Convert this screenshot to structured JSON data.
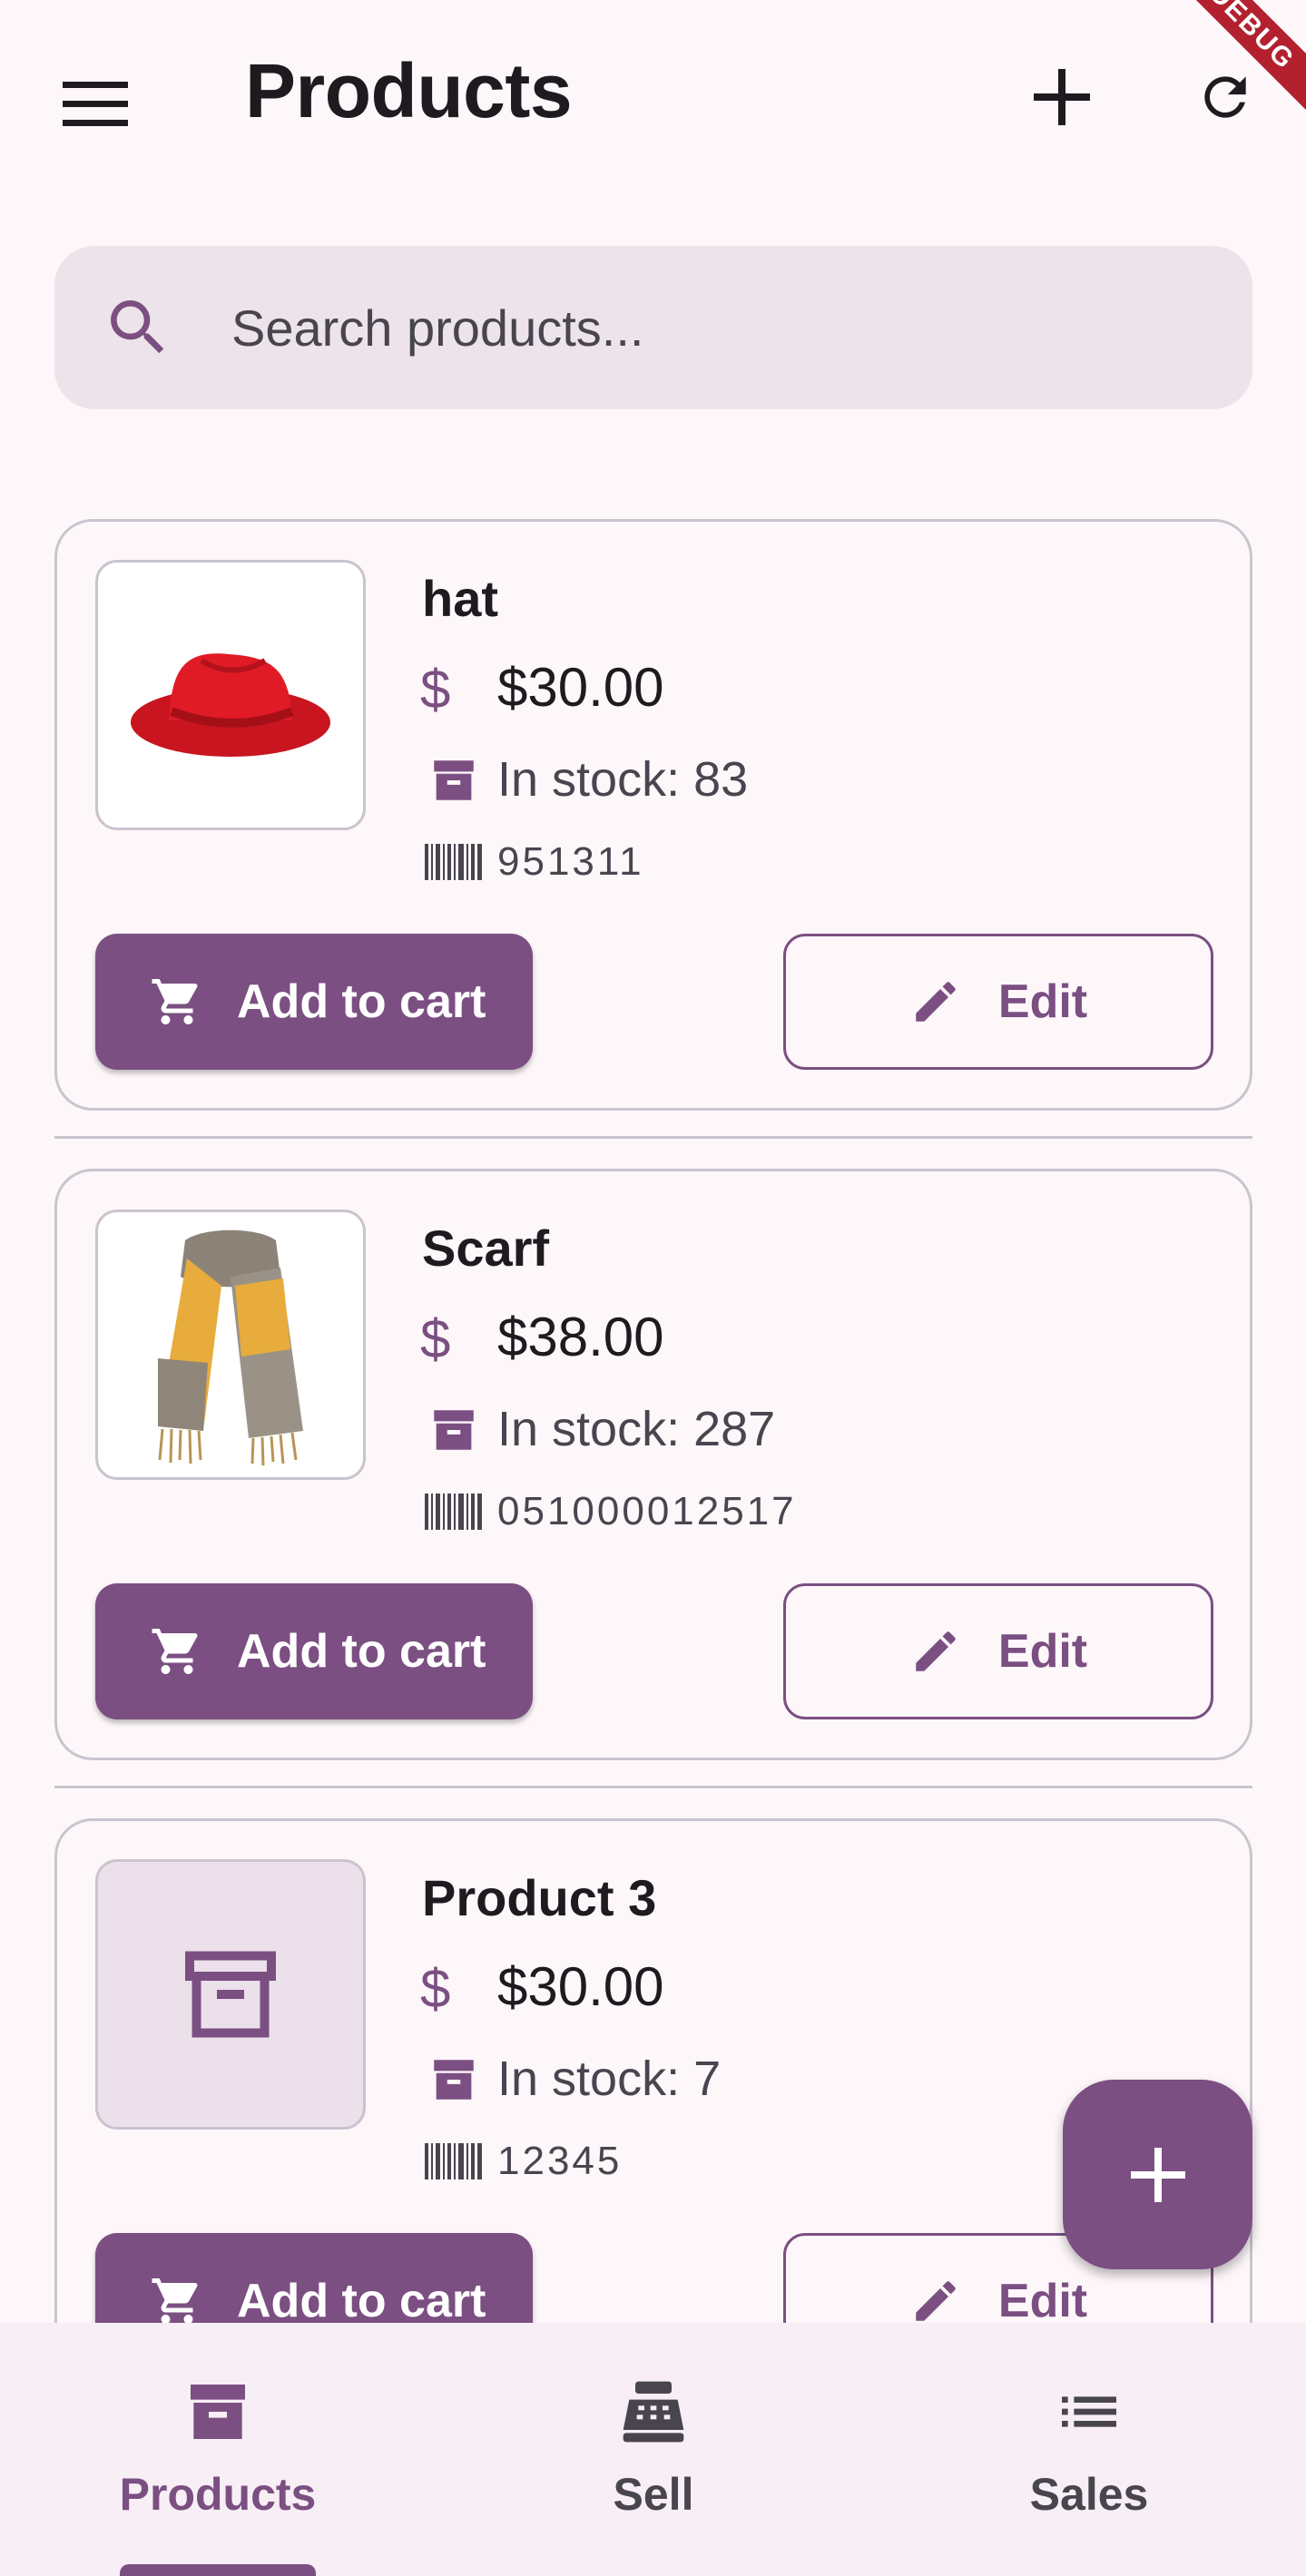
{
  "app_bar": {
    "title": "Products",
    "menu_icon": "menu-icon",
    "add_icon": "add-icon",
    "refresh_icon": "refresh-icon",
    "debug_banner": "DEBUG"
  },
  "search": {
    "placeholder": "Search products...",
    "value": "",
    "icon": "search-icon"
  },
  "products": [
    {
      "name": "hat",
      "price": "$30.00",
      "stock": "In stock: 83",
      "barcode": "951311",
      "image": "red-hat-photo"
    },
    {
      "name": "Scarf",
      "price": "$38.00",
      "stock": "In stock: 287",
      "barcode": "051000012517",
      "image": "scarf-photo"
    },
    {
      "name": "Product 3",
      "price": "$30.00",
      "stock": "In stock: 7",
      "barcode": "12345",
      "image": "archive-placeholder-icon"
    }
  ],
  "buttons": {
    "add_to_cart": "Add to cart",
    "edit": "Edit",
    "price_symbol": "$"
  },
  "fab": {
    "icon": "add-icon"
  },
  "bottom_nav": {
    "items": [
      {
        "label": "Products",
        "icon": "archive-icon",
        "active": true
      },
      {
        "label": "Sell",
        "icon": "cash-register-icon",
        "active": false
      },
      {
        "label": "Sales",
        "icon": "list-icon",
        "active": false
      }
    ]
  },
  "colors": {
    "primary": "#7b4f82",
    "background": "#fef7fa",
    "search_bg": "#ece4ea",
    "outline": "#cac4cf"
  }
}
